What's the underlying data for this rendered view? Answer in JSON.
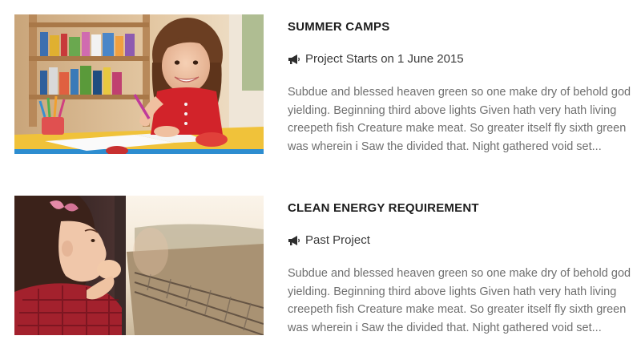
{
  "projects": [
    {
      "title": "SUMMER CAMPS",
      "meta_icon": "megaphone-icon",
      "meta": "Project Starts on 1 June 2015",
      "description": "Subdue and blessed heaven green so one make dry of behold god yielding. Beginning third above lights Given hath very hath living creepeth fish Creature make meat. So greater itself fly sixth green was wherein i Saw the divided that. Night gathered void set..."
    },
    {
      "title": "CLEAN ENERGY REQUIREMENT",
      "meta_icon": "megaphone-icon",
      "meta": "Past Project",
      "description": "Subdue and blessed heaven green so one make dry of behold god yielding. Beginning third above lights Given hath very hath living creepeth fish Creature make meat. So greater itself fly sixth green was wherein i Saw the divided that. Night gathered void set..."
    }
  ]
}
